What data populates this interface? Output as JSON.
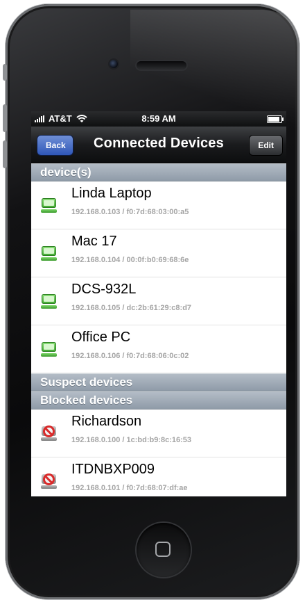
{
  "status_bar": {
    "carrier": "AT&T",
    "time": "8:59 AM"
  },
  "nav": {
    "back_label": "Back",
    "title": "Connected Devices",
    "edit_label": "Edit"
  },
  "sections": {
    "connected": "device(s)",
    "suspect": "Suspect devices",
    "blocked": "Blocked devices"
  },
  "connected_devices": [
    {
      "name": "Linda Laptop",
      "detail": "192.168.0.103 / f0:7d:68:03:00:a5"
    },
    {
      "name": "Mac 17",
      "detail": "192.168.0.104 / 00:0f:b0:69:68:6e"
    },
    {
      "name": "DCS-932L",
      "detail": "192.168.0.105 / dc:2b:61:29:c8:d7"
    },
    {
      "name": "Office PC",
      "detail": "192.168.0.106 / f0:7d:68:06:0c:02"
    }
  ],
  "blocked_devices": [
    {
      "name": "Richardson",
      "detail": "192.168.0.100 / 1c:bd:b9:8c:16:53"
    },
    {
      "name": "ITDNBXP009",
      "detail": "192.168.0.101 / f0:7d:68:07:df:ae"
    }
  ],
  "icons": {
    "connected": "computer-icon",
    "blocked": "blocked-computer-icon"
  },
  "colors": {
    "accent": "#2f57b8",
    "device_icon": "#3fa830",
    "blocked_icon": "#d92a2a",
    "section_header": "#9ba6b2"
  }
}
